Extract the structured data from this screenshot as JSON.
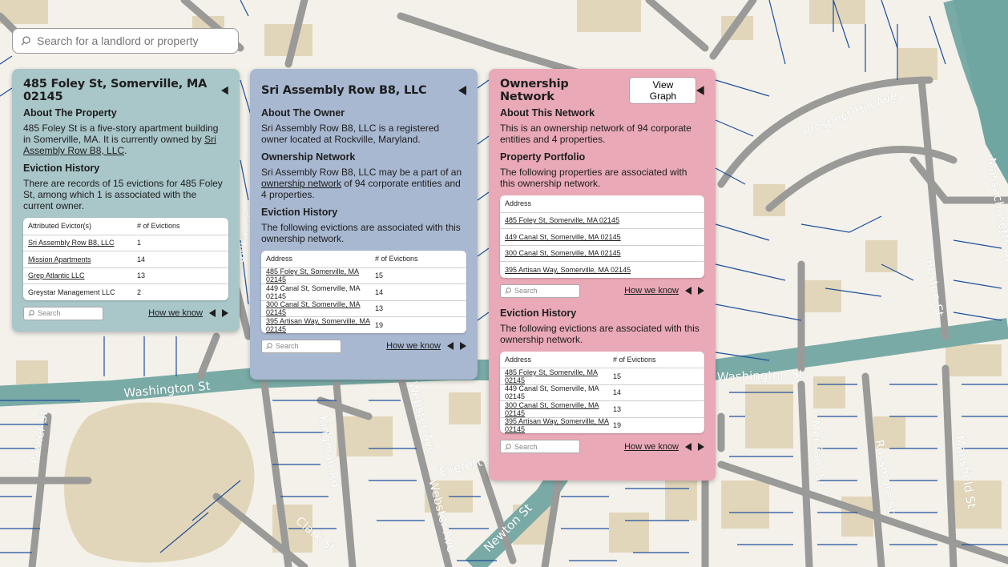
{
  "search": {
    "placeholder": "Search for a landlord or property"
  },
  "map": {
    "streets": [
      "Washington St",
      "Washington St",
      "Webster Ave",
      "Webster Ave",
      "Prospect Hill Ave",
      "Boston St",
      "Merriam St",
      "Massachusetts Ave",
      "Everett St",
      "Newton St",
      "Clark St",
      "Parker St",
      "Kingman Rd",
      "Mansfield St",
      "Rossmore St",
      "Hawkins St"
    ],
    "colors": {
      "land": "#f3f1ea",
      "building": "#e0d4b8",
      "road": "#9a9a98",
      "parcel": "#1f4f9a",
      "water": "#6fa6a2"
    }
  },
  "panels": {
    "property": {
      "title": "485 Foley St, Somerville, MA 02145",
      "about_heading": "About The Property",
      "about_text": "485 Foley St is a five-story apartment building in Somerville, MA. It is currently owned by ",
      "owner_link": "Sri Assembly Row B8, LLC",
      "about_end": ".",
      "eviction_heading": "Eviction History",
      "eviction_text": "There are records of 15 evictions for 485 Foley St, among which 1 is associated with the current owner.",
      "table": {
        "headers": [
          "Attributed Evictor(s)",
          "# of Evictions"
        ],
        "rows": [
          [
            "Sri Assembly Row B8, LLC",
            "1"
          ],
          [
            "Mission Apartments",
            "14"
          ],
          [
            "Grep Atlantic LLC",
            "13"
          ],
          [
            "Greystar Management LLC",
            "2"
          ]
        ]
      },
      "search_placeholder": "Search",
      "how_we_know": "How we know"
    },
    "owner": {
      "title": "Sri Assembly Row B8, LLC",
      "about_heading": "About The Owner",
      "about_text": "Sri Assembly Row B8, LLC is a registered owner located at Rockville, Maryland.",
      "network_heading": "Ownership Network",
      "network_text_1": "Sri Assembly Row B8, LLC may be a part of an ",
      "network_link": "ownership network",
      "network_text_2": " of 94 corporate entities and 4 properties.",
      "eviction_heading": "Eviction History",
      "eviction_text": "The following evictions are associated with this ownership network.",
      "table": {
        "headers": [
          "Address",
          "# of Evictions"
        ],
        "rows": [
          [
            "485 Foley St, Somerville, MA 02145",
            "15"
          ],
          [
            "449 Canal St, Somerville, MA 02145",
            "14"
          ],
          [
            "300 Canal St, Somerville, MA 02145",
            "13"
          ],
          [
            "395 Artisan Way, Somerville, MA 02145",
            "19"
          ]
        ]
      },
      "search_placeholder": "Search",
      "how_we_know": "How we know"
    },
    "network": {
      "title": "Ownership Network",
      "view_graph": "View Graph",
      "about_heading": "About This Network",
      "about_text": "This is an ownership network of 94 corporate entities and 4 properties.",
      "portfolio_heading": "Property Portfolio",
      "portfolio_text": "The following properties are associated with this ownership network.",
      "portfolio_table": {
        "headers": [
          "Address"
        ],
        "rows": [
          [
            "485 Foley St, Somerville, MA 02145"
          ],
          [
            "449 Canal St, Somerville, MA 02145"
          ],
          [
            "300 Canal St, Somerville, MA 02145"
          ],
          [
            "395 Artisan Way, Somerville, MA 02145"
          ]
        ]
      },
      "eviction_heading": "Eviction History",
      "eviction_text": "The following evictions are associated with this ownership network.",
      "eviction_table": {
        "headers": [
          "Address",
          "# of Evictions"
        ],
        "rows": [
          [
            "485 Foley St, Somerville, MA 02145",
            "15"
          ],
          [
            "449 Canal St, Somerville, MA 02145",
            "14"
          ],
          [
            "300 Canal St, Somerville, MA 02145",
            "13"
          ],
          [
            "395 Artisan Way, Somerville, MA 02145",
            "19"
          ]
        ]
      },
      "search_placeholder": "Search",
      "how_we_know": "How we know"
    }
  }
}
